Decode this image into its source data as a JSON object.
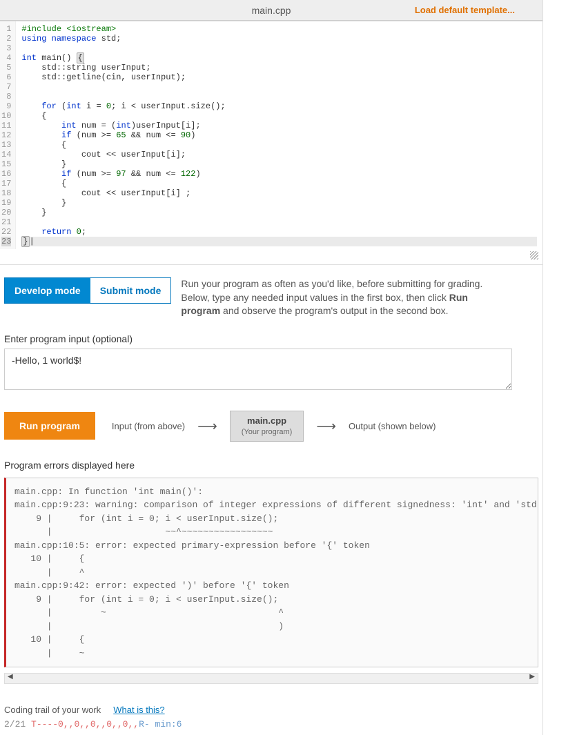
{
  "header": {
    "filename": "main.cpp",
    "load_template": "Load default template..."
  },
  "code_lines": [
    {
      "n": 1,
      "segs": [
        {
          "t": "#include <iostream>",
          "c": "kw-pre"
        }
      ]
    },
    {
      "n": 2,
      "segs": [
        {
          "t": "using ",
          "c": "kw-blue"
        },
        {
          "t": "namespace ",
          "c": "kw-blue"
        },
        {
          "t": "std;",
          "c": ""
        }
      ]
    },
    {
      "n": 3,
      "segs": [
        {
          "t": "",
          "c": ""
        }
      ]
    },
    {
      "n": 4,
      "segs": [
        {
          "t": "int ",
          "c": "kw-blue"
        },
        {
          "t": "main() ",
          "c": ""
        },
        {
          "t": "{",
          "c": "brace"
        }
      ]
    },
    {
      "n": 5,
      "segs": [
        {
          "t": "    std::string userInput;",
          "c": ""
        }
      ]
    },
    {
      "n": 6,
      "segs": [
        {
          "t": "    std::getline(cin, userInput);",
          "c": ""
        }
      ]
    },
    {
      "n": 7,
      "segs": [
        {
          "t": "",
          "c": ""
        }
      ]
    },
    {
      "n": 8,
      "segs": [
        {
          "t": "",
          "c": ""
        }
      ]
    },
    {
      "n": 9,
      "segs": [
        {
          "t": "    ",
          "c": ""
        },
        {
          "t": "for ",
          "c": "kw-blue"
        },
        {
          "t": "(",
          "c": ""
        },
        {
          "t": "int ",
          "c": "kw-blue"
        },
        {
          "t": "i = ",
          "c": ""
        },
        {
          "t": "0",
          "c": "num"
        },
        {
          "t": "; i < userInput.size();",
          "c": ""
        }
      ]
    },
    {
      "n": 10,
      "segs": [
        {
          "t": "    {",
          "c": ""
        }
      ]
    },
    {
      "n": 11,
      "segs": [
        {
          "t": "        ",
          "c": ""
        },
        {
          "t": "int ",
          "c": "kw-blue"
        },
        {
          "t": "num = (",
          "c": ""
        },
        {
          "t": "int",
          "c": "kw-blue"
        },
        {
          "t": ")userInput[i];",
          "c": ""
        }
      ]
    },
    {
      "n": 12,
      "segs": [
        {
          "t": "        ",
          "c": ""
        },
        {
          "t": "if ",
          "c": "kw-blue"
        },
        {
          "t": "(num >= ",
          "c": ""
        },
        {
          "t": "65",
          "c": "num"
        },
        {
          "t": " && num <= ",
          "c": ""
        },
        {
          "t": "90",
          "c": "num"
        },
        {
          "t": ")",
          "c": ""
        }
      ]
    },
    {
      "n": 13,
      "segs": [
        {
          "t": "        {",
          "c": ""
        }
      ]
    },
    {
      "n": 14,
      "segs": [
        {
          "t": "            cout << userInput[i];",
          "c": ""
        }
      ]
    },
    {
      "n": 15,
      "segs": [
        {
          "t": "        }",
          "c": ""
        }
      ]
    },
    {
      "n": 16,
      "segs": [
        {
          "t": "        ",
          "c": ""
        },
        {
          "t": "if ",
          "c": "kw-blue"
        },
        {
          "t": "(num >= ",
          "c": ""
        },
        {
          "t": "97",
          "c": "num"
        },
        {
          "t": " && num <= ",
          "c": ""
        },
        {
          "t": "122",
          "c": "num"
        },
        {
          "t": ")",
          "c": ""
        }
      ]
    },
    {
      "n": 17,
      "segs": [
        {
          "t": "        {",
          "c": ""
        }
      ]
    },
    {
      "n": 18,
      "segs": [
        {
          "t": "            cout << userInput[i] ;",
          "c": ""
        }
      ]
    },
    {
      "n": 19,
      "segs": [
        {
          "t": "        }",
          "c": ""
        }
      ]
    },
    {
      "n": 20,
      "segs": [
        {
          "t": "    }",
          "c": ""
        }
      ]
    },
    {
      "n": 21,
      "segs": [
        {
          "t": "",
          "c": ""
        }
      ]
    },
    {
      "n": 22,
      "segs": [
        {
          "t": "    ",
          "c": ""
        },
        {
          "t": "return ",
          "c": "kw-blue"
        },
        {
          "t": "0",
          "c": "num"
        },
        {
          "t": ";",
          "c": ""
        }
      ]
    },
    {
      "n": 23,
      "hl": true,
      "segs": [
        {
          "t": "}",
          "c": "brace"
        },
        {
          "t": "|",
          "c": ""
        }
      ]
    }
  ],
  "modes": {
    "develop": "Develop mode",
    "submit": "Submit mode",
    "desc_pre": "Run your program as often as you'd like, before submitting for grading. Below, type any needed input values in the first box, then click ",
    "desc_bold": "Run program",
    "desc_post": " and observe the program's output in the second box."
  },
  "input": {
    "label": "Enter program input (optional)",
    "value": "-Hello, 1 world$!"
  },
  "run": {
    "button": "Run program",
    "input_label": "Input (from above)",
    "box_title": "main.cpp",
    "box_sub": "(Your program)",
    "output_label": "Output (shown below)"
  },
  "errors": {
    "label": "Program errors displayed here",
    "text": "main.cpp: In function 'int main()':\nmain.cpp:9:23: warning: comparison of integer expressions of different signedness: 'int' and 'std\n    9 |     for (int i = 0; i < userInput.size();\n      |                     ~~^~~~~~~~~~~~~~~~~~\nmain.cpp:10:5: error: expected primary-expression before '{' token\n   10 |     {\n      |     ^\nmain.cpp:9:42: error: expected ')' before '{' token\n    9 |     for (int i = 0; i < userInput.size();\n      |         ~                                ^\n      |                                          )\n   10 |     {\n      |     ~"
  },
  "trail": {
    "label": "Coding trail of your work",
    "link": "What is this?",
    "date": "2/21",
    "seq1": "T----0,,0,,0,,0,,0,,",
    "seq2": "R- min:6"
  }
}
